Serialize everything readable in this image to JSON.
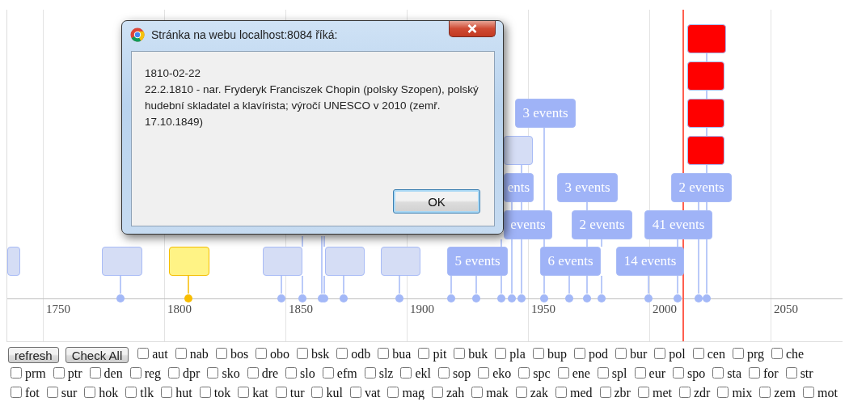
{
  "timeline": {
    "axis_labels": [
      "1750",
      "1800",
      "1850",
      "1900",
      "1950",
      "2000",
      "2050"
    ],
    "items": [
      {
        "color": "#d5ddf5",
        "selected": false
      },
      {
        "color": "#d5ddf5",
        "selected": false
      },
      {
        "color": "#fff385",
        "selected": true
      },
      {
        "color": "#d5ddf5",
        "selected": false
      },
      {
        "color": "#d5ddf5",
        "selected": false
      },
      {
        "color": "#d5ddf5",
        "selected": false
      },
      {
        "label": "5 events",
        "color": "#9fb3f7",
        "selected": false
      },
      {
        "label": "6 events",
        "color": "#9fb3f7",
        "selected": false
      },
      {
        "label": "14 events",
        "color": "#9fb3f7",
        "selected": false
      },
      {
        "label": "3 events",
        "color": "#9fb3f7",
        "selected": false
      },
      {
        "color": "#d5ddf5",
        "selected": false
      },
      {
        "label": "ents",
        "color": "#9fb3f7",
        "selected": false
      },
      {
        "label": "events",
        "color": "#9fb3f7",
        "selected": false
      },
      {
        "label": "3 events",
        "color": "#9fb3f7",
        "selected": false
      },
      {
        "label": "2 events",
        "color": "#9fb3f7",
        "selected": false
      },
      {
        "color": "#ff0000",
        "selected": false
      },
      {
        "color": "#ff0000",
        "selected": false
      },
      {
        "color": "#ff0000",
        "selected": false
      },
      {
        "color": "#ff0000",
        "selected": false
      },
      {
        "label": "2 events",
        "color": "#9fb3f7",
        "selected": false
      },
      {
        "label": "41 events",
        "color": "#9fb3f7",
        "selected": false
      }
    ]
  },
  "dialog": {
    "title": "Stránka na webu localhost:8084 říká:",
    "date": "1810-02-22",
    "message": "22.2.1810 - nar. Fryderyk Franciszek Chopin (polsky Szopen), polský hudební skladatel a klavírista; výročí UNESCO v 2010 (zemř. 17.10.1849)",
    "ok_button": "OK"
  },
  "controls": {
    "buttons": [
      "refresh",
      "Check All"
    ],
    "filters": [
      {
        "label": "aut",
        "checked": false
      },
      {
        "label": "nab",
        "checked": false
      },
      {
        "label": "bos",
        "checked": false
      },
      {
        "label": "obo",
        "checked": false
      },
      {
        "label": "bsk",
        "checked": false
      },
      {
        "label": "odb",
        "checked": false
      },
      {
        "label": "bua",
        "checked": false
      },
      {
        "label": "pit",
        "checked": false
      },
      {
        "label": "buk",
        "checked": false
      },
      {
        "label": "pla",
        "checked": false
      },
      {
        "label": "bup",
        "checked": false
      },
      {
        "label": "pod",
        "checked": false
      },
      {
        "label": "bur",
        "checked": false
      },
      {
        "label": "pol",
        "checked": false
      },
      {
        "label": "cen",
        "checked": false
      },
      {
        "label": "prg",
        "checked": false
      },
      {
        "label": "che",
        "checked": false
      },
      {
        "label": "prm",
        "checked": false
      },
      {
        "label": "ptr",
        "checked": false
      },
      {
        "label": "den",
        "checked": false
      },
      {
        "label": "reg",
        "checked": false
      },
      {
        "label": "dpr",
        "checked": false
      },
      {
        "label": "sko",
        "checked": false
      },
      {
        "label": "dre",
        "checked": false
      },
      {
        "label": "slo",
        "checked": false
      },
      {
        "label": "efm",
        "checked": false
      },
      {
        "label": "slz",
        "checked": false
      },
      {
        "label": "ekl",
        "checked": false
      },
      {
        "label": "sop",
        "checked": false
      },
      {
        "label": "eko",
        "checked": false
      },
      {
        "label": "spc",
        "checked": false
      },
      {
        "label": "ene",
        "checked": false
      },
      {
        "label": "spl",
        "checked": false
      },
      {
        "label": "eur",
        "checked": false
      },
      {
        "label": "spo",
        "checked": false
      },
      {
        "label": "sta",
        "checked": false
      },
      {
        "label": "for",
        "checked": false
      },
      {
        "label": "str",
        "checked": false
      },
      {
        "label": "fot",
        "checked": false
      },
      {
        "label": "sur",
        "checked": false
      },
      {
        "label": "hok",
        "checked": false
      },
      {
        "label": "tlk",
        "checked": false
      },
      {
        "label": "hut",
        "checked": false
      },
      {
        "label": "tok",
        "checked": false
      },
      {
        "label": "kat",
        "checked": false
      },
      {
        "label": "tur",
        "checked": false
      },
      {
        "label": "kul",
        "checked": false
      },
      {
        "label": "vat",
        "checked": false
      },
      {
        "label": "mag",
        "checked": false
      },
      {
        "label": "zah",
        "checked": false
      },
      {
        "label": "mak",
        "checked": false
      },
      {
        "label": "zak",
        "checked": false
      },
      {
        "label": "med",
        "checked": false
      },
      {
        "label": "zbr",
        "checked": false
      },
      {
        "label": "met",
        "checked": false
      },
      {
        "label": "zdr",
        "checked": false
      },
      {
        "label": "mix",
        "checked": false
      },
      {
        "label": "zem",
        "checked": false
      },
      {
        "label": "mot",
        "checked": false
      }
    ]
  }
}
